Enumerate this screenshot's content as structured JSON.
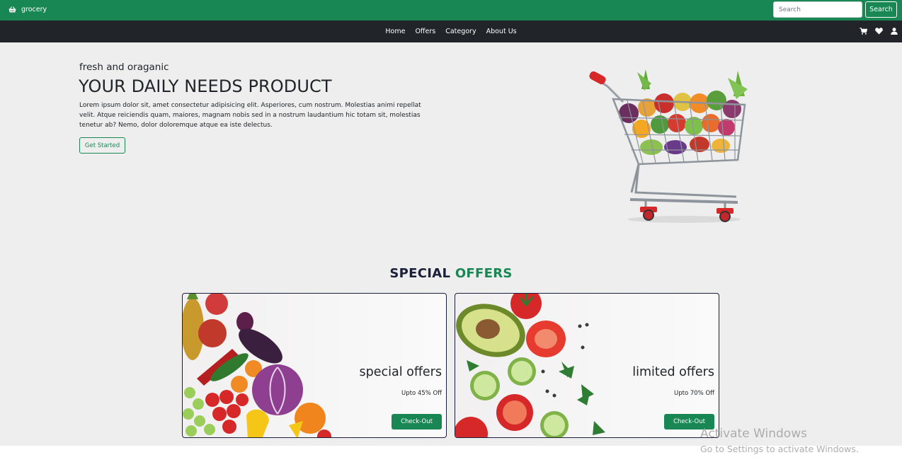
{
  "header": {
    "brand": "grocery",
    "brand_icon": "basket-icon",
    "search_placeholder": "Search",
    "search_button": "Search",
    "colors": {
      "primary": "#198754",
      "nav": "#212529"
    }
  },
  "nav": {
    "links": [
      "Home",
      "Offers",
      "Category",
      "About Us"
    ],
    "icons": [
      "cart-icon",
      "heart-icon",
      "user-icon"
    ]
  },
  "hero": {
    "subtitle": "fresh and oraganic",
    "title": "YOUR DAILY NEEDS PRODUCT",
    "description": "Lorem ipsum dolor sit, amet consectetur adipisicing elit. Asperiores, cum nostrum. Molestias animi repellat velit. Atque reiciendis quam, maiores, magnam nobis sed in a nostrum laudantium hic totam sit, molestias tenetur ab? Nemo, dolor doloremque atque ea iste delectus.",
    "cta": "Get Started"
  },
  "offers": {
    "heading_part1": "SPECIAL",
    "heading_part2": "OFFERS",
    "cards": [
      {
        "title": "special offers",
        "discount": "Upto 45% Off",
        "button": "Check-Out"
      },
      {
        "title": "limited offers",
        "discount": "Upto 70% Off",
        "button": "Check-Out"
      }
    ]
  },
  "watermark": {
    "line1": "Activate Windows",
    "line2": "Go to Settings to activate Windows."
  }
}
